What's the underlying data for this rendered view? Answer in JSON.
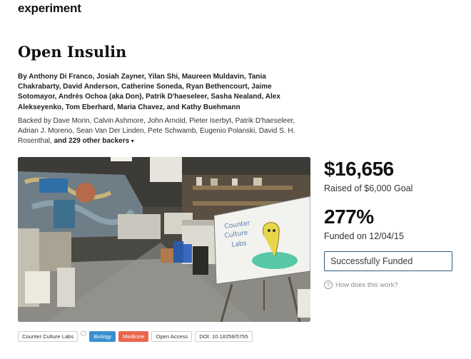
{
  "brand": "experiment",
  "title": "Open Insulin",
  "authors": {
    "prefix": "By ",
    "names": "Anthony Di Franco, Josiah Zayner, Yilan Shi, Maureen Muldavin, Tania Chakrabarty, David Anderson, Catherine Soneda, Ryan Bethencourt, Jaime Sotomayor, Andrés Ochoa (aka Don), Patrik D'haeseleer, Sasha Nealand, Alex Alekseyenko, Tom Eberhard, Maria Chavez, and Kathy Buehmann"
  },
  "backers": {
    "text": "Backed by Dave Morin, Calvin Ashmore, John Arnold, Pieter Iserbyt, Patrik D'haeseleer, Adrian J. Moreno, Sean Van Der Linden, Pete Schwamb, Eugenio Polanski, David S. H. Rosenthal, ",
    "more_link": "and 229 other backers",
    "more_icon": "chevron-down-icon"
  },
  "hero": {
    "board_text_1": "Counter",
    "board_text_2": "Culture",
    "board_text_3": "Labs"
  },
  "stats": {
    "raised": "$16,656",
    "raised_sub": "Raised of $6,000 Goal",
    "percent": "277%",
    "percent_sub": "Funded on 12/04/15",
    "status_button": "Successfully Funded",
    "how_link": "How does this work?",
    "how_icon": "question-circle-icon"
  },
  "tags": [
    "Counter Culture Labs",
    "",
    "Biology",
    "Medicine",
    "Open Access",
    "DOI: 10.18258/5755"
  ],
  "colors": {
    "biology": "#3a8fd0",
    "medicine": "#e9664d",
    "button_border": "#2f5d7c"
  }
}
